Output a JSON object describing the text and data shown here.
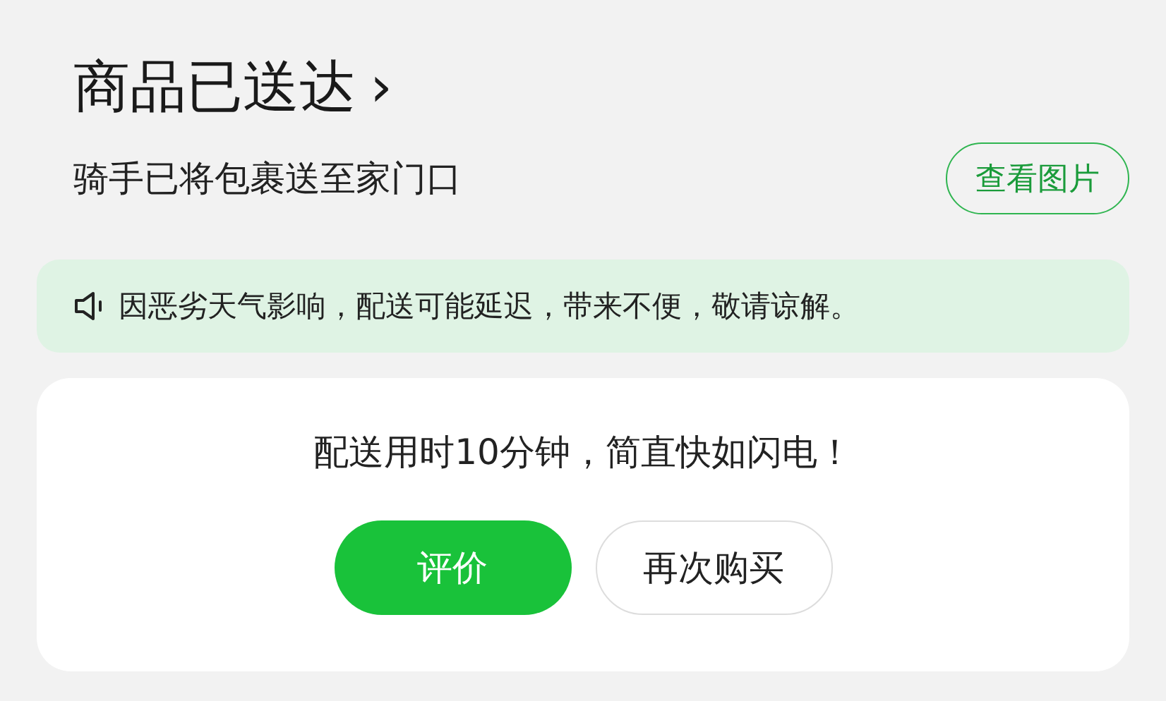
{
  "header": {
    "title": "商品已送达",
    "chevron": "›",
    "subtitle": "骑手已将包裹送至家门口",
    "photo_button": "查看图片"
  },
  "notice": {
    "text": "因恶劣天气影响，配送可能延迟，带来不便，敬请谅解。"
  },
  "card": {
    "message": "配送用时10分钟，简直快如闪电！",
    "buttons": [
      {
        "label": "评价",
        "kind": "primary"
      },
      {
        "label": "再次购买",
        "kind": "outline"
      }
    ]
  }
}
